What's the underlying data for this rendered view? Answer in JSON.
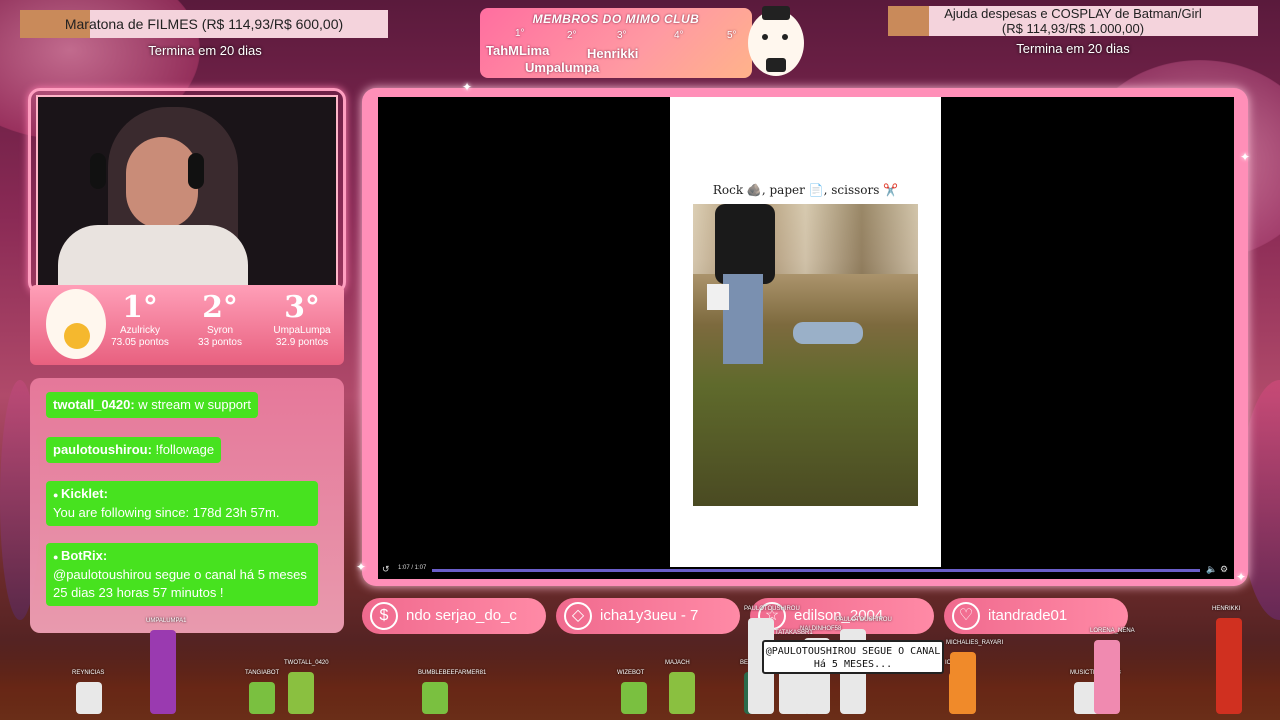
{
  "goals": {
    "left": {
      "title": "Maratona de FILMES (R$ 114,93/R$ 600,00)",
      "sub": "Termina em 20 dias",
      "progress": 0.19
    },
    "right": {
      "title": "Ajuda despesas e COSPLAY de Batman/Girl",
      "amount": "(R$ 114,93/R$ 1.000,00)",
      "sub": "Termina em 20 dias",
      "progress": 0.11
    }
  },
  "members": {
    "title": "MEMBROS DO MIMO CLUB",
    "ranks": [
      "1°",
      "2°",
      "3°",
      "4°",
      "5°"
    ],
    "names": [
      "TahMLima",
      "Henrikki",
      "Umpalumpa"
    ]
  },
  "ranking": [
    {
      "pos": "1°",
      "name": "Azulricky",
      "points": "73.05 pontos"
    },
    {
      "pos": "2°",
      "name": "Syron",
      "points": "33 pontos"
    },
    {
      "pos": "3°",
      "name": "UmpaLumpa",
      "points": "32.9 pontos"
    }
  ],
  "chat": [
    {
      "user": "twotall_0420:",
      "text": " w stream w support"
    },
    {
      "user": "paulotoushirou:",
      "text": " !followage"
    },
    {
      "user": "Kicklet:",
      "text": "You are following since: 178d 23h 57m."
    },
    {
      "user": "BotRix:",
      "text": "@paulotoushirou segue o canal há 5 meses 25 dias 23 horas 57 minutos !"
    }
  ],
  "video": {
    "caption": "Rock 🪨, paper 📄, scissors ✂️",
    "time": "1:07 / 1:07",
    "progress": 1.0
  },
  "events": [
    {
      "icon": "$",
      "text": "ndo   serjao_do_c"
    },
    {
      "icon": "◇",
      "text": "icha1y3ueu - 7"
    },
    {
      "icon": "☆",
      "text": "edilson_2004"
    },
    {
      "icon": "♡",
      "text": "itandrade01"
    }
  ],
  "tooltip": "@PAULOTOUSHIROU SEGUE O CANAL Há 5 MESES...",
  "viewer_names": [
    "REYNICIAS",
    "UMPALUMPA1",
    "TANGIABOT",
    "TWOTALL_0420",
    "BUMBLEBEEFARMER81",
    "WIZEBOT",
    "MAJACH",
    "BETOUJI",
    "SWSNAC",
    "NALDINHOF58",
    "PAULOTOUSHIROU",
    "TATAKASBR1",
    "PAULOTOUSHIROU",
    "ICHAR1B",
    "MICHALIES_RAYARI",
    "MUSICTRENER88",
    "LORENA_NENA",
    "HENRIKKI"
  ],
  "colors": {
    "accent": "#ff8fb8",
    "chat_green": "#47e21f",
    "progress": "#6a5ec9"
  }
}
